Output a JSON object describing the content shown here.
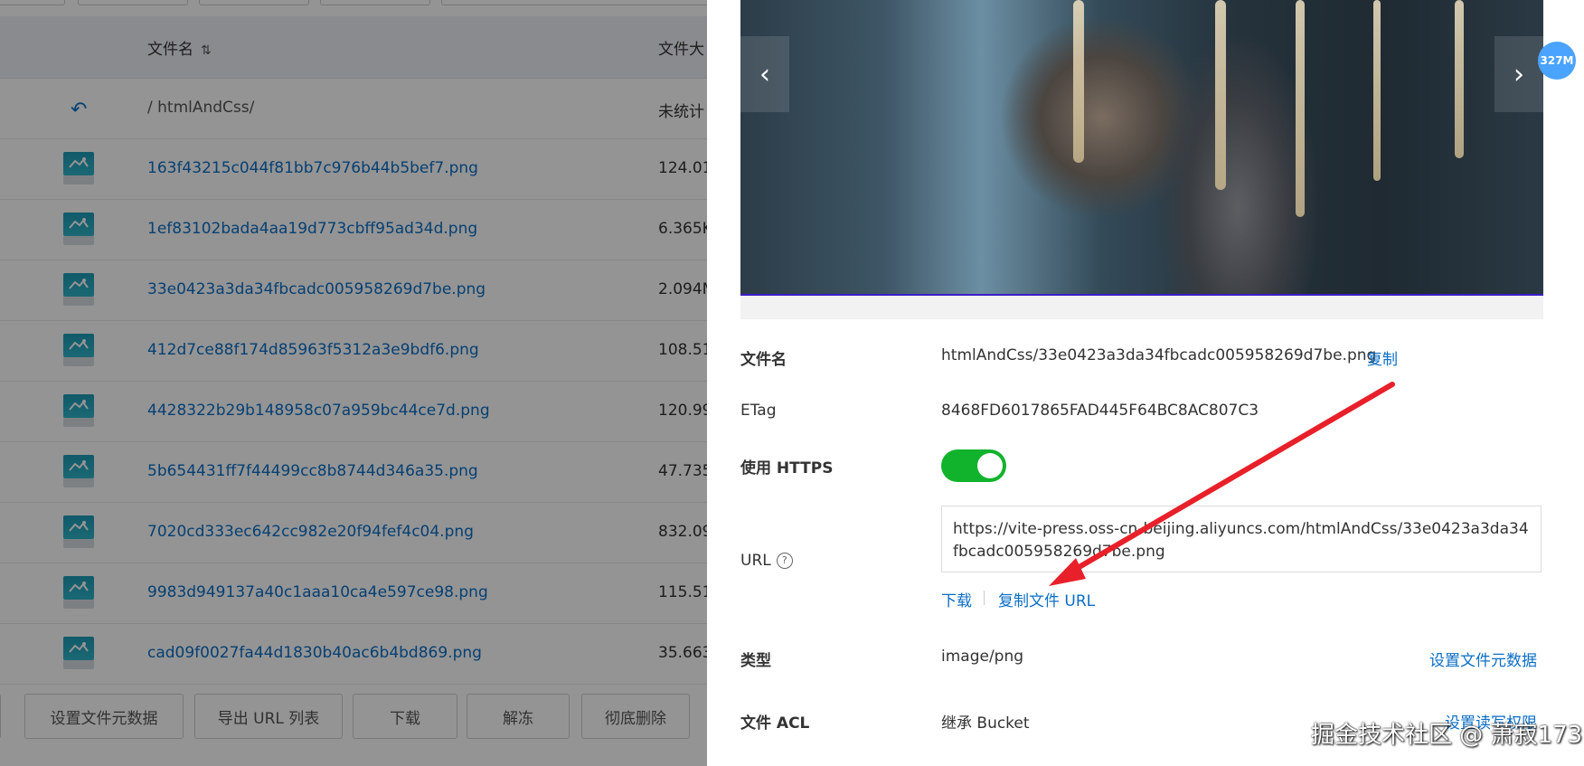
{
  "file_list": {
    "header": {
      "name": "文件名",
      "size": "文件大"
    },
    "back_row": {
      "path": "/ htmlAndCss/",
      "size": "未统计"
    },
    "rows": [
      {
        "name": "163f43215c044f81bb7c976b44b5bef7.png",
        "size": "124.01"
      },
      {
        "name": "1ef83102bada4aa19d773cbff95ad34d.png",
        "size": "6.365K"
      },
      {
        "name": "33e0423a3da34fbcadc005958269d7be.png",
        "size": "2.094M"
      },
      {
        "name": "412d7ce88f174d85963f5312a3e9bdf6.png",
        "size": "108.51"
      },
      {
        "name": "4428322b29b148958c07a959bc44ce7d.png",
        "size": "120.99"
      },
      {
        "name": "5b654431ff7f44499cc8b8744d346a35.png",
        "size": "47.735"
      },
      {
        "name": "7020cd333ec642cc982e20f94fef4c04.png",
        "size": "832.09"
      },
      {
        "name": "9983d949137a40c1aaa10ca4e597ce98.png",
        "size": "115.51"
      },
      {
        "name": "cad09f0027fa44d1830b40ac6b4bd869.png",
        "size": "35.663"
      }
    ],
    "bottom_buttons": [
      "设置文件元数据",
      "导出 URL 列表",
      "下载",
      "解冻",
      "彻底删除"
    ]
  },
  "detail": {
    "size_badge": "327M",
    "filename_label": "文件名",
    "filename_value": "htmlAndCss/33e0423a3da34fbcadc005958269d7be.png",
    "copy_label": "复制",
    "etag_label": "ETag",
    "etag_value": "8468FD6017865FAD445F64BC8AC807C3",
    "https_label": "使用 HTTPS",
    "https_enabled": true,
    "url_label": "URL",
    "url_value": "https://vite-press.oss-cn-beijing.aliyuncs.com/htmlAndCss/33e0423a3da34fbcadc005958269d7be.png",
    "download_label": "下载",
    "copy_url_label": "复制文件 URL",
    "type_label": "类型",
    "type_value": "image/png",
    "set_meta_label": "设置文件元数据",
    "acl_label": "文件 ACL",
    "acl_value": "继承 Bucket",
    "set_acl_label": "设置读写权限"
  },
  "watermark": "掘金技术社区 @ 萧寂173",
  "colors": {
    "link": "#0b6ec6",
    "toggle_on": "#11b32c",
    "badge": "#4aa3ff",
    "annotation_arrow": "#e8202a"
  }
}
